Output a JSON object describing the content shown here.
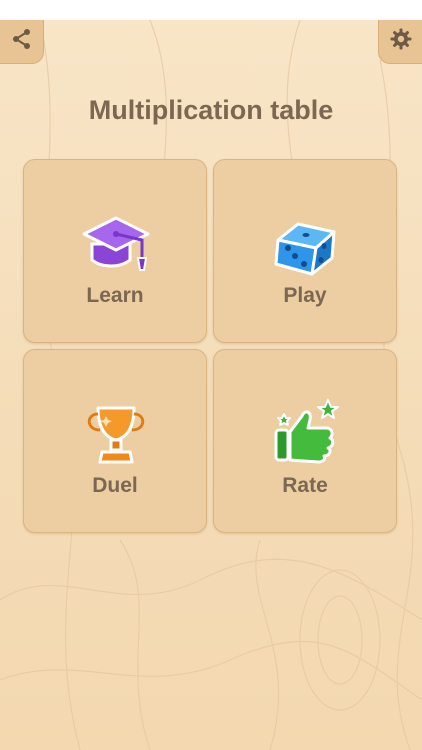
{
  "header": {
    "title": "Multiplication table",
    "share_icon": "share-icon",
    "settings_icon": "gear-icon"
  },
  "menu": {
    "items": [
      {
        "label": "Learn",
        "icon": "graduation-cap-icon",
        "color": "#9b57e6"
      },
      {
        "label": "Play",
        "icon": "dice-icon",
        "color": "#2e95ea"
      },
      {
        "label": "Duel",
        "icon": "trophy-icon",
        "color": "#f08a1c"
      },
      {
        "label": "Rate",
        "icon": "thumbs-up-icon",
        "color": "#3fb63b"
      }
    ]
  },
  "colors": {
    "background": "#f7e3c4",
    "tile": "#edcea2",
    "text": "#7c6752",
    "corner_button": "#e8c394"
  }
}
